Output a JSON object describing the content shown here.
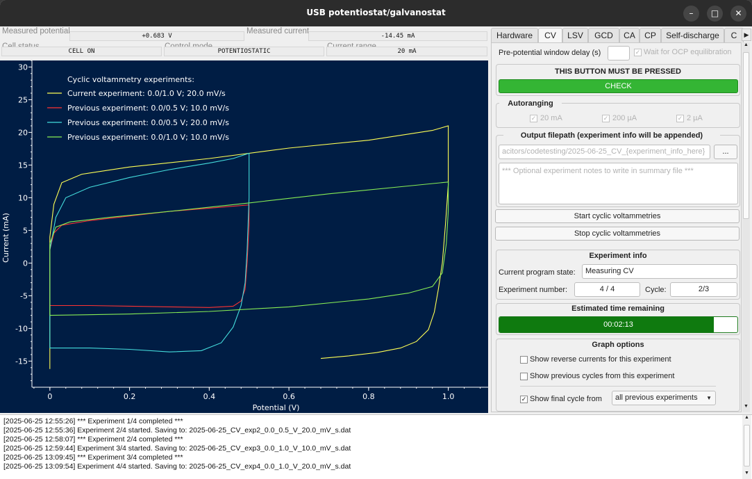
{
  "window": {
    "title": "USB potentiostat/galvanostat"
  },
  "status": {
    "measured_potential_label": "Measured potential",
    "measured_potential": "+0.683 V",
    "measured_current_label": "Measured current",
    "measured_current": "-14.45 mA",
    "cell_status_label": "Cell status",
    "cell_status": "CELL ON",
    "control_mode_label": "Control mode",
    "control_mode": "POTENTIOSTATIC",
    "current_range_label": "Current range",
    "current_range": "20 mA"
  },
  "tabs": [
    "Hardware",
    "CV",
    "LSV",
    "GCD",
    "CA",
    "CP",
    "Self-discharge",
    "C"
  ],
  "active_tab": "CV",
  "cv": {
    "prepotential_label": "Pre-potential window delay (s)",
    "wait_ocp_label": "Wait for OCP equilibration",
    "must_press_title": "THIS BUTTON MUST BE PRESSED",
    "check_label": "CHECK",
    "autoranging_title": "Autoranging",
    "range_20mA": "20 mA",
    "range_200uA": "200 µA",
    "range_2uA": "2 µA",
    "output_title": "Output filepath (experiment info will be appended)",
    "output_path": "acitors/codetesting/2025-06-25_CV_{experiment_info_here}",
    "browse_label": "...",
    "notes_placeholder": "*** Optional experiment notes to write in summary file ***",
    "start_label": "Start cyclic voltammetries",
    "stop_label": "Stop cyclic voltammetries",
    "exp_info_title": "Experiment info",
    "program_state_label": "Current program state:",
    "program_state": "Measuring CV",
    "exp_number_label": "Experiment number:",
    "exp_number": "4 / 4",
    "cycle_label": "Cycle:",
    "cycle": "2/3",
    "time_title": "Estimated time remaining",
    "time_remaining": "00:02:13",
    "time_progress": 0.9,
    "graph_title": "Graph options",
    "opt_reverse": "Show reverse currents for this experiment",
    "opt_prev_cycles": "Show previous cycles from this experiment",
    "opt_final": "Show final cycle from",
    "opt_final_select": "all previous experiments"
  },
  "log": [
    "[2025-06-25 12:55:26] *** Experiment 1/4 completed ***",
    "[2025-06-25 12:55:36] Experiment 2/4 started. Saving to: 2025-06-25_CV_exp2_0.0_0.5_V_20.0_mV_s.dat",
    "[2025-06-25 12:58:07] *** Experiment 2/4 completed ***",
    "[2025-06-25 12:59:44] Experiment 3/4 started. Saving to: 2025-06-25_CV_exp3_0.0_1.0_V_10.0_mV_s.dat",
    "[2025-06-25 13:09:45] *** Experiment 3/4 completed ***",
    "[2025-06-25 13:09:54] Experiment 4/4 started. Saving to: 2025-06-25_CV_exp4_0.0_1.0_V_20.0_mV_s.dat"
  ],
  "chart_data": {
    "type": "line",
    "xlabel": "Potential (V)",
    "ylabel": "Current (mA)",
    "xlim": [
      -0.045,
      1.1
    ],
    "ylim": [
      -19,
      31
    ],
    "xticks": [
      0,
      0.2,
      0.4,
      0.6,
      0.8,
      1.0
    ],
    "xtick_labels": [
      "0",
      "0.2",
      "0.4",
      "0.6",
      "0.8",
      "1.0"
    ],
    "yticks": [
      -15,
      -10,
      -5,
      0,
      5,
      10,
      15,
      20,
      25,
      30
    ],
    "ytick_labels": [
      "-15",
      "-10",
      "-5",
      "0",
      "5",
      "10",
      "15",
      "20",
      "25",
      "30"
    ],
    "legend_title": "Cyclic voltammetry experiments:",
    "legend_position": "top-left",
    "background": "#001d44",
    "series": [
      {
        "name": "Current experiment: 0.0/1.0 V; 20.0 mV/s",
        "color": "#ffff55",
        "points": [
          [
            0.68,
            -14.6
          ],
          [
            0.75,
            -14.2
          ],
          [
            0.82,
            -13.7
          ],
          [
            0.88,
            -13.0
          ],
          [
            0.92,
            -12.0
          ],
          [
            0.95,
            -10.2
          ],
          [
            0.965,
            -7.5
          ],
          [
            0.975,
            -4.0
          ],
          [
            0.985,
            0
          ],
          [
            0.993,
            6
          ],
          [
            1.0,
            12
          ],
          [
            1.0,
            21.0
          ],
          [
            0.96,
            20.3
          ],
          [
            0.8,
            18.8
          ],
          [
            0.6,
            17.6
          ],
          [
            0.4,
            16.0
          ],
          [
            0.2,
            14.7
          ],
          [
            0.08,
            13.6
          ],
          [
            0.03,
            12.3
          ],
          [
            0.01,
            9
          ],
          [
            0.0,
            4
          ],
          [
            0.0,
            -16.2
          ]
        ]
      },
      {
        "name": "Previous experiment: 0.0/0.5 V; 10.0 mV/s",
        "color": "#ff3333",
        "points": [
          [
            0.0,
            -6.5
          ],
          [
            0.1,
            -6.5
          ],
          [
            0.2,
            -6.6
          ],
          [
            0.3,
            -6.7
          ],
          [
            0.4,
            -6.8
          ],
          [
            0.46,
            -6.6
          ],
          [
            0.48,
            -5.8
          ],
          [
            0.49,
            -4.0
          ],
          [
            0.495,
            0
          ],
          [
            0.5,
            6
          ],
          [
            0.5,
            8.9
          ],
          [
            0.4,
            8.4
          ],
          [
            0.3,
            7.9
          ],
          [
            0.2,
            7.2
          ],
          [
            0.1,
            6.5
          ],
          [
            0.03,
            5.8
          ],
          [
            0.01,
            4.6
          ],
          [
            0.0,
            2
          ],
          [
            0.0,
            -6.5
          ]
        ]
      },
      {
        "name": "Previous experiment: 0.0/0.5 V; 20.0 mV/s",
        "color": "#44dddd",
        "points": [
          [
            0.0,
            -13.0
          ],
          [
            0.1,
            -13.0
          ],
          [
            0.2,
            -13.2
          ],
          [
            0.3,
            -13.6
          ],
          [
            0.38,
            -13.4
          ],
          [
            0.43,
            -12.2
          ],
          [
            0.46,
            -9.8
          ],
          [
            0.48,
            -6.5
          ],
          [
            0.49,
            -3
          ],
          [
            0.495,
            2
          ],
          [
            0.5,
            10
          ],
          [
            0.5,
            16.8
          ],
          [
            0.46,
            16.0
          ],
          [
            0.4,
            15.3
          ],
          [
            0.3,
            14.3
          ],
          [
            0.2,
            13.1
          ],
          [
            0.1,
            11.6
          ],
          [
            0.04,
            10.0
          ],
          [
            0.015,
            7
          ],
          [
            0.0,
            2
          ],
          [
            0.0,
            -13.0
          ]
        ]
      },
      {
        "name": "Previous experiment: 0.0/1.0 V; 10.0 mV/s",
        "color": "#88ee55",
        "points": [
          [
            0.0,
            -8.0
          ],
          [
            0.2,
            -7.8
          ],
          [
            0.4,
            -7.4
          ],
          [
            0.6,
            -6.7
          ],
          [
            0.8,
            -5.5
          ],
          [
            0.9,
            -4.6
          ],
          [
            0.96,
            -3.6
          ],
          [
            0.985,
            -1.5
          ],
          [
            0.995,
            3
          ],
          [
            1.0,
            8
          ],
          [
            1.0,
            12.4
          ],
          [
            0.9,
            11.8
          ],
          [
            0.7,
            10.6
          ],
          [
            0.5,
            9.2
          ],
          [
            0.3,
            7.9
          ],
          [
            0.15,
            7.0
          ],
          [
            0.05,
            6.3
          ],
          [
            0.015,
            5.5
          ],
          [
            0.0,
            3
          ],
          [
            0.0,
            -8.0
          ]
        ]
      }
    ]
  }
}
